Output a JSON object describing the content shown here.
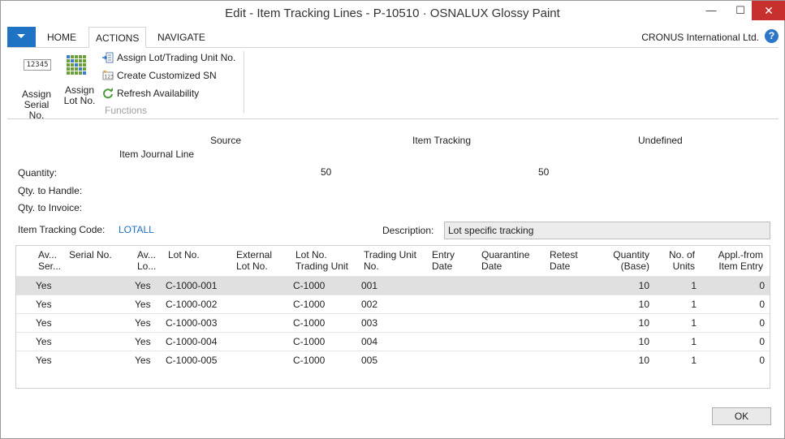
{
  "window": {
    "title": "Edit - Item Tracking Lines - P-10510 · OSNALUX Glossy Paint",
    "min_glyph": "—",
    "max_glyph": "☐",
    "close_glyph": "✕"
  },
  "ribbon": {
    "tabs": [
      {
        "label": "HOME",
        "active": false
      },
      {
        "label": "ACTIONS",
        "active": true
      },
      {
        "label": "NAVIGATE",
        "active": false
      }
    ],
    "company": "CRONUS International Ltd.",
    "help_glyph": "?",
    "actions": {
      "assign_serial_line1": "Assign",
      "assign_serial_line2": "Serial No.",
      "serial_icon_text": "12345",
      "assign_lot_line1": "Assign",
      "assign_lot_line2": "Lot No.",
      "assign_lot_trading_unit": "Assign Lot/Trading Unit No.",
      "create_customized_sn": "Create Customized SN",
      "refresh_availability": "Refresh Availability",
      "group_label": "Functions"
    }
  },
  "summary": {
    "col_source": "Source",
    "col_source_sub": "Item Journal Line",
    "col_item_tracking": "Item Tracking",
    "col_undefined": "Undefined",
    "quantity_label": "Quantity:",
    "quantity_source": "50",
    "quantity_tracking": "50",
    "qty_to_handle_label": "Qty. to Handle:",
    "qty_to_invoice_label": "Qty. to Invoice:",
    "item_tracking_code_label": "Item Tracking Code:",
    "item_tracking_code_value": "LOTALL",
    "description_label": "Description:",
    "description_value": "Lot specific tracking"
  },
  "grid": {
    "headers": {
      "avail_serial": [
        "Av...",
        "Ser..."
      ],
      "serial_no": [
        "Serial No.",
        ""
      ],
      "avail_lot": [
        "Av...",
        "Lo..."
      ],
      "lot_no": [
        "Lot No.",
        ""
      ],
      "external_lot_no": [
        "External",
        "Lot No."
      ],
      "lot_no_trading_unit": [
        "Lot No.",
        "Trading Unit"
      ],
      "trading_unit_no": [
        "Trading Unit",
        "No."
      ],
      "entry_date": [
        "Entry",
        "Date"
      ],
      "quarantine_date": [
        "Quarantine",
        "Date"
      ],
      "retest_date": [
        "Retest",
        "Date"
      ],
      "quantity_base": [
        "Quantity",
        "(Base)"
      ],
      "no_of_units": [
        "No. of",
        "Units"
      ],
      "appl_from_item_entry": [
        "Appl.-from",
        "Item Entry"
      ]
    },
    "rows": [
      {
        "avail_serial": "Yes",
        "avail_lot": "Yes",
        "lot_no": "C-1000-001",
        "lot_tu": "C-1000",
        "tu_no": "001",
        "qty": "10",
        "units": "1",
        "appl": "0"
      },
      {
        "avail_serial": "Yes",
        "avail_lot": "Yes",
        "lot_no": "C-1000-002",
        "lot_tu": "C-1000",
        "tu_no": "002",
        "qty": "10",
        "units": "1",
        "appl": "0"
      },
      {
        "avail_serial": "Yes",
        "avail_lot": "Yes",
        "lot_no": "C-1000-003",
        "lot_tu": "C-1000",
        "tu_no": "003",
        "qty": "10",
        "units": "1",
        "appl": "0"
      },
      {
        "avail_serial": "Yes",
        "avail_lot": "Yes",
        "lot_no": "C-1000-004",
        "lot_tu": "C-1000",
        "tu_no": "004",
        "qty": "10",
        "units": "1",
        "appl": "0"
      },
      {
        "avail_serial": "Yes",
        "avail_lot": "Yes",
        "lot_no": "C-1000-005",
        "lot_tu": "C-1000",
        "tu_no": "005",
        "qty": "10",
        "units": "1",
        "appl": "0"
      }
    ],
    "selected_row_index": 0
  },
  "footer": {
    "ok_label": "OK"
  },
  "colors": {
    "app_button": "#1e73c5",
    "close_button": "#c7312d",
    "link": "#1f6fbf",
    "selected_row": "#e0e0e0"
  },
  "icons": {
    "app_menu": "chevron-down-icon",
    "serial": "serial-number-icon",
    "lot": "lot-grid-icon",
    "assign_lot_tu": "assign-lot-icon",
    "create_sn": "create-sn-icon",
    "refresh": "refresh-icon",
    "help": "help-icon"
  }
}
